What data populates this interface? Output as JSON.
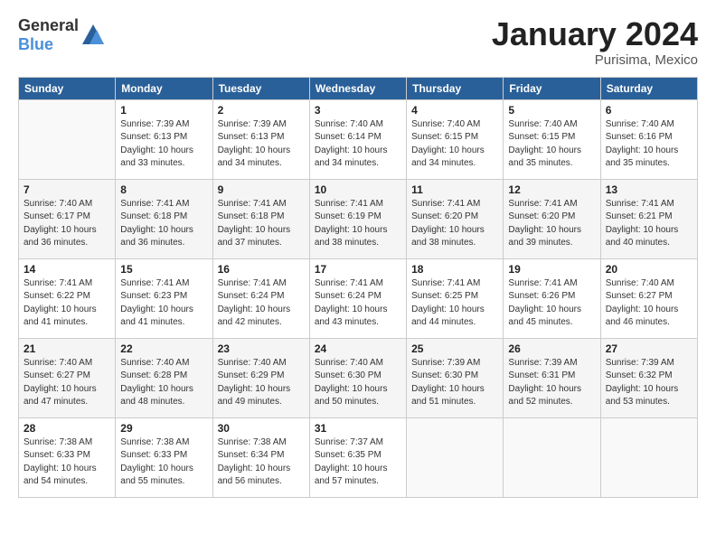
{
  "header": {
    "logo_general": "General",
    "logo_blue": "Blue",
    "title": "January 2024",
    "subtitle": "Purisima, Mexico"
  },
  "days_of_week": [
    "Sunday",
    "Monday",
    "Tuesday",
    "Wednesday",
    "Thursday",
    "Friday",
    "Saturday"
  ],
  "weeks": [
    {
      "days": [
        {
          "num": "",
          "info": ""
        },
        {
          "num": "1",
          "info": "Sunrise: 7:39 AM\nSunset: 6:13 PM\nDaylight: 10 hours\nand 33 minutes."
        },
        {
          "num": "2",
          "info": "Sunrise: 7:39 AM\nSunset: 6:13 PM\nDaylight: 10 hours\nand 34 minutes."
        },
        {
          "num": "3",
          "info": "Sunrise: 7:40 AM\nSunset: 6:14 PM\nDaylight: 10 hours\nand 34 minutes."
        },
        {
          "num": "4",
          "info": "Sunrise: 7:40 AM\nSunset: 6:15 PM\nDaylight: 10 hours\nand 34 minutes."
        },
        {
          "num": "5",
          "info": "Sunrise: 7:40 AM\nSunset: 6:15 PM\nDaylight: 10 hours\nand 35 minutes."
        },
        {
          "num": "6",
          "info": "Sunrise: 7:40 AM\nSunset: 6:16 PM\nDaylight: 10 hours\nand 35 minutes."
        }
      ]
    },
    {
      "days": [
        {
          "num": "7",
          "info": "Sunrise: 7:40 AM\nSunset: 6:17 PM\nDaylight: 10 hours\nand 36 minutes."
        },
        {
          "num": "8",
          "info": "Sunrise: 7:41 AM\nSunset: 6:18 PM\nDaylight: 10 hours\nand 36 minutes."
        },
        {
          "num": "9",
          "info": "Sunrise: 7:41 AM\nSunset: 6:18 PM\nDaylight: 10 hours\nand 37 minutes."
        },
        {
          "num": "10",
          "info": "Sunrise: 7:41 AM\nSunset: 6:19 PM\nDaylight: 10 hours\nand 38 minutes."
        },
        {
          "num": "11",
          "info": "Sunrise: 7:41 AM\nSunset: 6:20 PM\nDaylight: 10 hours\nand 38 minutes."
        },
        {
          "num": "12",
          "info": "Sunrise: 7:41 AM\nSunset: 6:20 PM\nDaylight: 10 hours\nand 39 minutes."
        },
        {
          "num": "13",
          "info": "Sunrise: 7:41 AM\nSunset: 6:21 PM\nDaylight: 10 hours\nand 40 minutes."
        }
      ]
    },
    {
      "days": [
        {
          "num": "14",
          "info": "Sunrise: 7:41 AM\nSunset: 6:22 PM\nDaylight: 10 hours\nand 41 minutes."
        },
        {
          "num": "15",
          "info": "Sunrise: 7:41 AM\nSunset: 6:23 PM\nDaylight: 10 hours\nand 41 minutes."
        },
        {
          "num": "16",
          "info": "Sunrise: 7:41 AM\nSunset: 6:24 PM\nDaylight: 10 hours\nand 42 minutes."
        },
        {
          "num": "17",
          "info": "Sunrise: 7:41 AM\nSunset: 6:24 PM\nDaylight: 10 hours\nand 43 minutes."
        },
        {
          "num": "18",
          "info": "Sunrise: 7:41 AM\nSunset: 6:25 PM\nDaylight: 10 hours\nand 44 minutes."
        },
        {
          "num": "19",
          "info": "Sunrise: 7:41 AM\nSunset: 6:26 PM\nDaylight: 10 hours\nand 45 minutes."
        },
        {
          "num": "20",
          "info": "Sunrise: 7:40 AM\nSunset: 6:27 PM\nDaylight: 10 hours\nand 46 minutes."
        }
      ]
    },
    {
      "days": [
        {
          "num": "21",
          "info": "Sunrise: 7:40 AM\nSunset: 6:27 PM\nDaylight: 10 hours\nand 47 minutes."
        },
        {
          "num": "22",
          "info": "Sunrise: 7:40 AM\nSunset: 6:28 PM\nDaylight: 10 hours\nand 48 minutes."
        },
        {
          "num": "23",
          "info": "Sunrise: 7:40 AM\nSunset: 6:29 PM\nDaylight: 10 hours\nand 49 minutes."
        },
        {
          "num": "24",
          "info": "Sunrise: 7:40 AM\nSunset: 6:30 PM\nDaylight: 10 hours\nand 50 minutes."
        },
        {
          "num": "25",
          "info": "Sunrise: 7:39 AM\nSunset: 6:30 PM\nDaylight: 10 hours\nand 51 minutes."
        },
        {
          "num": "26",
          "info": "Sunrise: 7:39 AM\nSunset: 6:31 PM\nDaylight: 10 hours\nand 52 minutes."
        },
        {
          "num": "27",
          "info": "Sunrise: 7:39 AM\nSunset: 6:32 PM\nDaylight: 10 hours\nand 53 minutes."
        }
      ]
    },
    {
      "days": [
        {
          "num": "28",
          "info": "Sunrise: 7:38 AM\nSunset: 6:33 PM\nDaylight: 10 hours\nand 54 minutes."
        },
        {
          "num": "29",
          "info": "Sunrise: 7:38 AM\nSunset: 6:33 PM\nDaylight: 10 hours\nand 55 minutes."
        },
        {
          "num": "30",
          "info": "Sunrise: 7:38 AM\nSunset: 6:34 PM\nDaylight: 10 hours\nand 56 minutes."
        },
        {
          "num": "31",
          "info": "Sunrise: 7:37 AM\nSunset: 6:35 PM\nDaylight: 10 hours\nand 57 minutes."
        },
        {
          "num": "",
          "info": ""
        },
        {
          "num": "",
          "info": ""
        },
        {
          "num": "",
          "info": ""
        }
      ]
    }
  ]
}
